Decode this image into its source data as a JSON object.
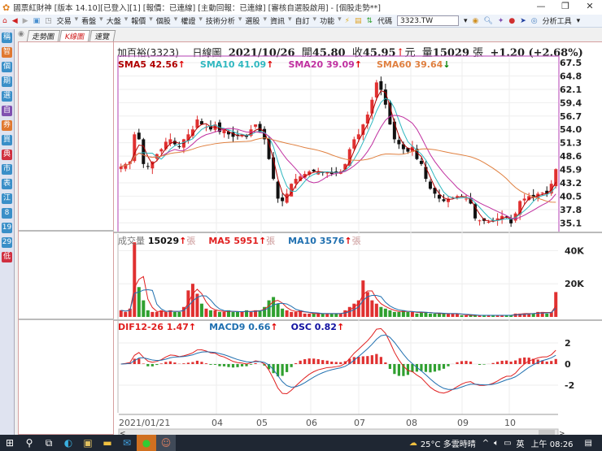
{
  "window": {
    "title": "國票紅財神 [版本 14.10][已登入][1] [報價：已連線] [主動回報：已連線] [審核自選股啟用] - [個股走勢**]",
    "minimize": "—",
    "restore": "❐",
    "close": "✕"
  },
  "toolbar": {
    "menus": [
      "交易",
      "看盤",
      "大盤",
      "報價",
      "個股",
      "權證",
      "技術分析",
      "選股",
      "資訊",
      "自訂",
      "功能"
    ],
    "code_label": "代碼",
    "code_value": "3323.TW",
    "analysis_tools": "分析工具"
  },
  "sidebar": {
    "buttons": [
      {
        "t": "稱",
        "c": "#3a8fc8"
      },
      {
        "t": "智",
        "c": "#e07830"
      },
      {
        "t": "個",
        "c": "#3a8fc8"
      },
      {
        "t": "期",
        "c": "#3a8fc8"
      },
      {
        "t": "選",
        "c": "#3a8fc8"
      },
      {
        "t": "自",
        "c": "#8050b0"
      },
      {
        "t": "券",
        "c": "#e07830"
      },
      {
        "t": "買",
        "c": "#3a8fc8"
      },
      {
        "t": "典",
        "c": "#d03040"
      },
      {
        "t": "市",
        "c": "#3a8fc8"
      },
      {
        "t": "表",
        "c": "#3a8fc8"
      },
      {
        "t": "江",
        "c": "#3a8fc8"
      },
      {
        "t": "8",
        "c": "#3a8fc8"
      },
      {
        "t": "19",
        "c": "#3a8fc8"
      },
      {
        "t": "29",
        "c": "#3a8fc8"
      },
      {
        "t": "低",
        "c": "#d03040"
      }
    ]
  },
  "tabs": [
    {
      "label": "走勢圖",
      "active": false
    },
    {
      "label": "K線圖",
      "active": true
    },
    {
      "label": "速覽",
      "active": false
    }
  ],
  "header": {
    "stock": "加百裕(3323)",
    "chart_type": "日線圖",
    "date": "2021/10/26",
    "open_label": "開",
    "open": "45.80",
    "close_label": "收",
    "close": "45.95",
    "close_unit": "元",
    "vol_label": "量",
    "volume": "15029",
    "vol_unit": "張",
    "change": "+1.20 (+2.68%)"
  },
  "indicators": {
    "sma": [
      {
        "label": "SMA5 42.56",
        "color": "#b00000",
        "dir": "up"
      },
      {
        "label": "SMA10 41.09",
        "color": "#30b8c0",
        "dir": "up"
      },
      {
        "label": "SMA20 39.09",
        "color": "#c030a0",
        "dir": "up"
      },
      {
        "label": "SMA60 39.64",
        "color": "#e08040",
        "dir": "down"
      }
    ],
    "volume": [
      {
        "label": "成交量",
        "value": "15029",
        "color": "#111"
      },
      {
        "label": "MA5",
        "value": "5951",
        "color": "#e02020"
      },
      {
        "label": "MA10",
        "value": "3576",
        "color": "#2070b0"
      }
    ],
    "vol_unit": "張",
    "macd": [
      {
        "label": "DIF12-26 1.47",
        "color": "#e02020"
      },
      {
        "label": "MACD9 0.66",
        "color": "#2070b0"
      },
      {
        "label": "OSC 0.82",
        "color": "#1010a0"
      }
    ]
  },
  "colors": {
    "up": "#e03030",
    "down": "#111111",
    "vol_up": "#e03030",
    "vol_down": "#30a030",
    "frame": "#c060c0"
  },
  "chart_data": {
    "type": "candlestick",
    "price_ticks": [
      "67.5",
      "64.8",
      "62.1",
      "59.4",
      "56.7",
      "54.0",
      "51.3",
      "48.6",
      "45.9",
      "43.2",
      "40.5",
      "37.8",
      "35.1"
    ],
    "price_range": [
      33.5,
      68.5
    ],
    "volume_ticks": [
      "40K",
      "20K"
    ],
    "macd_ticks": [
      "2",
      "0",
      "-2"
    ],
    "x_labels": [
      "2021/01/21",
      "04",
      "05",
      "06",
      "07",
      "08",
      "09",
      "10"
    ],
    "closes": [
      46.5,
      47,
      47.5,
      53,
      52,
      47,
      46.5,
      47.5,
      49,
      50,
      51.5,
      52,
      51,
      50.5,
      52,
      53,
      54,
      56,
      55,
      54.5,
      54,
      55,
      53.5,
      54,
      53,
      52.5,
      52.7,
      53,
      52.5,
      54,
      55,
      53.5,
      52,
      48,
      44,
      40,
      39.5,
      41,
      43,
      44,
      44.5,
      45,
      45.5,
      45.5,
      45.5,
      45.2,
      45.5,
      45,
      45.3,
      45.5,
      47,
      50,
      52,
      53,
      55,
      57,
      60,
      63.5,
      62,
      59,
      55,
      52,
      51,
      50,
      49.5,
      50.5,
      48,
      47,
      44,
      42,
      41,
      40,
      39.5,
      40,
      40.3,
      40.5,
      40.5,
      40,
      39,
      36,
      35.6,
      35.5,
      35.3,
      35.5,
      36,
      36.5,
      36.3,
      35,
      37,
      39.5,
      40,
      40.5,
      40.3,
      41,
      41.2,
      41,
      43,
      45.95
    ],
    "volumes_k": [
      4,
      3,
      5,
      45,
      18,
      10,
      4,
      3,
      3,
      4,
      3,
      4,
      3,
      3,
      6,
      16,
      20,
      14,
      8,
      5,
      4,
      4,
      3,
      3,
      4,
      3,
      3,
      3,
      4,
      3,
      4,
      4,
      6,
      10,
      12,
      8,
      5,
      4,
      3,
      3,
      4,
      2,
      2,
      2,
      2,
      2,
      2,
      2,
      2,
      2,
      4,
      6,
      8,
      10,
      22,
      15,
      10,
      8,
      6,
      5,
      4,
      3,
      3,
      4,
      3,
      3,
      2,
      3,
      3,
      2,
      2,
      2,
      2,
      2,
      2,
      2,
      1,
      1,
      1,
      1,
      1,
      1,
      1,
      1,
      1,
      1,
      1,
      1,
      2,
      2,
      2,
      2,
      2,
      3,
      3,
      2,
      3,
      15
    ]
  },
  "date_axis": {
    "scroll_left": "<",
    "scroll_right": ">"
  },
  "taskbar": {
    "weather": "25°C 多雲時晴",
    "ime": "英",
    "clock": "上午 08:26"
  }
}
